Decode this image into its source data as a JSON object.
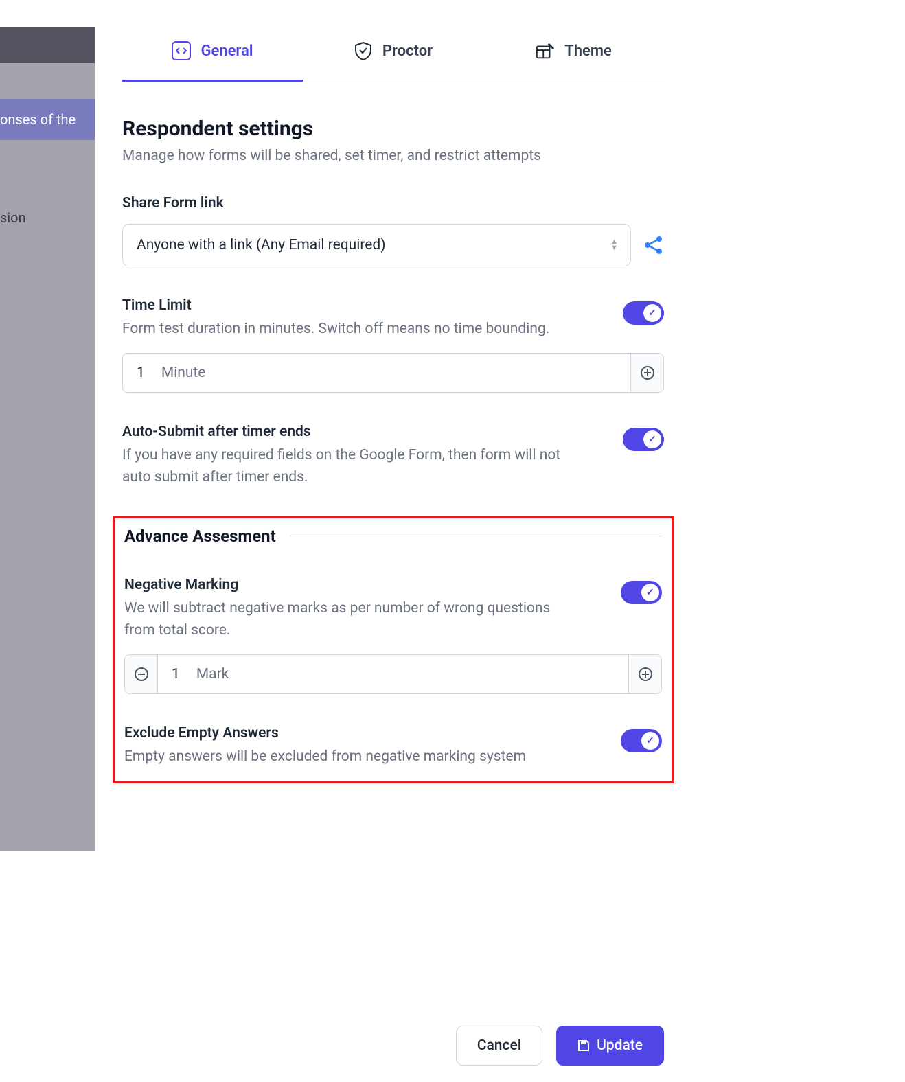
{
  "backdrop": {
    "row1_partial": "onses of the",
    "row2_partial": "sion"
  },
  "tabs": {
    "general": "General",
    "proctor": "Proctor",
    "theme": "Theme"
  },
  "respondent": {
    "title": "Respondent settings",
    "subtitle": "Manage how forms will be shared, set timer, and restrict attempts"
  },
  "share": {
    "label": "Share Form link",
    "selected": "Anyone with a link (Any Email required)"
  },
  "time_limit": {
    "label": "Time Limit",
    "desc": "Form test duration in minutes. Switch off means no time bounding.",
    "value": "1",
    "unit": "Minute"
  },
  "auto_submit": {
    "label": "Auto-Submit after timer ends",
    "desc": "If you have any required fields on the Google Form, then form will not auto submit after timer ends."
  },
  "advance": {
    "heading": "Advance Assesment"
  },
  "negative": {
    "label": "Negative Marking",
    "desc": "We will subtract negative marks as per number of wrong questions from total score.",
    "value": "1",
    "unit": "Mark"
  },
  "exclude": {
    "label": "Exclude Empty Answers",
    "desc": "Empty answers will be excluded from negative marking system"
  },
  "footer": {
    "cancel": "Cancel",
    "update": "Update"
  }
}
